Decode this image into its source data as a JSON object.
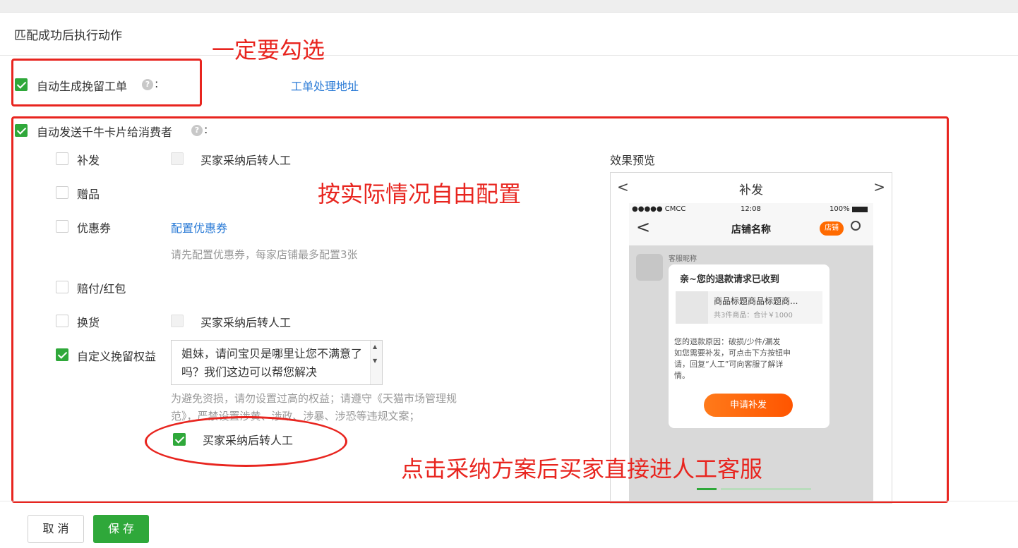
{
  "section": {
    "title": "匹配成功后执行动作"
  },
  "auto_ticket": {
    "label": "自动生成挽留工单",
    "checked": true,
    "help_icon": "help-icon",
    "colon": ":",
    "link": "工单处理地址"
  },
  "auto_card": {
    "label": "自动发送千牛卡片给消费者",
    "checked": true,
    "colon": ":"
  },
  "options": [
    {
      "label": "补发",
      "checked": false,
      "sub_checkbox_label": "买家采纳后转人工"
    },
    {
      "label": "赠品",
      "checked": false
    },
    {
      "label": "优惠券",
      "checked": false,
      "link": "配置优惠券",
      "hint": "请先配置优惠券，每家店铺最多配置3张"
    },
    {
      "label": "赔付/红包",
      "checked": false
    },
    {
      "label": "换货",
      "checked": false,
      "sub_checkbox_label": "买家采纳后转人工"
    },
    {
      "label": "自定义挽留权益",
      "checked": true,
      "textarea_value": "姐妹，请问宝贝是哪里让您不满意了吗？我们这边可以帮您解决",
      "hint_line1": "为避免资损，请勿设置过高的权益；请遵守《天猫市场管理规",
      "hint_line2": "范》，严禁设置涉黄、涉政、涉暴、涉恐等违规文案；",
      "sub_checkbox_label": "买家采纳后转人工",
      "sub_checked": true
    }
  ],
  "preview": {
    "title": "效果预览",
    "nav_title": "补发",
    "prev_icon": "chevron-left-icon",
    "next_icon": "chevron-right-icon",
    "status_carrier": "●●●●● CMCC",
    "status_time": "12:08",
    "status_battery": "100%",
    "shop_name": "店铺名称",
    "shop_badge": "店铺",
    "nickname": "客服昵称",
    "bubble_title": "亲~您的退款请求已收到",
    "product_title": "商品标题商品标题商...",
    "product_meta": "共3件商品：合计￥1000",
    "message_line1": "您的退款原因：破损/少件/漏发",
    "message_line2": "如您需要补发，可点击下方按钮申",
    "message_line3": "请，回复“人工”可向客服了解详",
    "message_line4": "情。",
    "apply_button": "申请补发"
  },
  "annotations": {
    "must_check": "一定要勾选",
    "free_config": "按实际情况自由配置",
    "adopt_note": "点击采纳方案后买家直接进人工客服"
  },
  "footer": {
    "cancel": "取 消",
    "save": "保 存"
  },
  "colors": {
    "accent_green": "#2fa83a",
    "link_blue": "#2b7bd6",
    "annotation_red": "#e8251f",
    "orange": "#ff6a00"
  }
}
